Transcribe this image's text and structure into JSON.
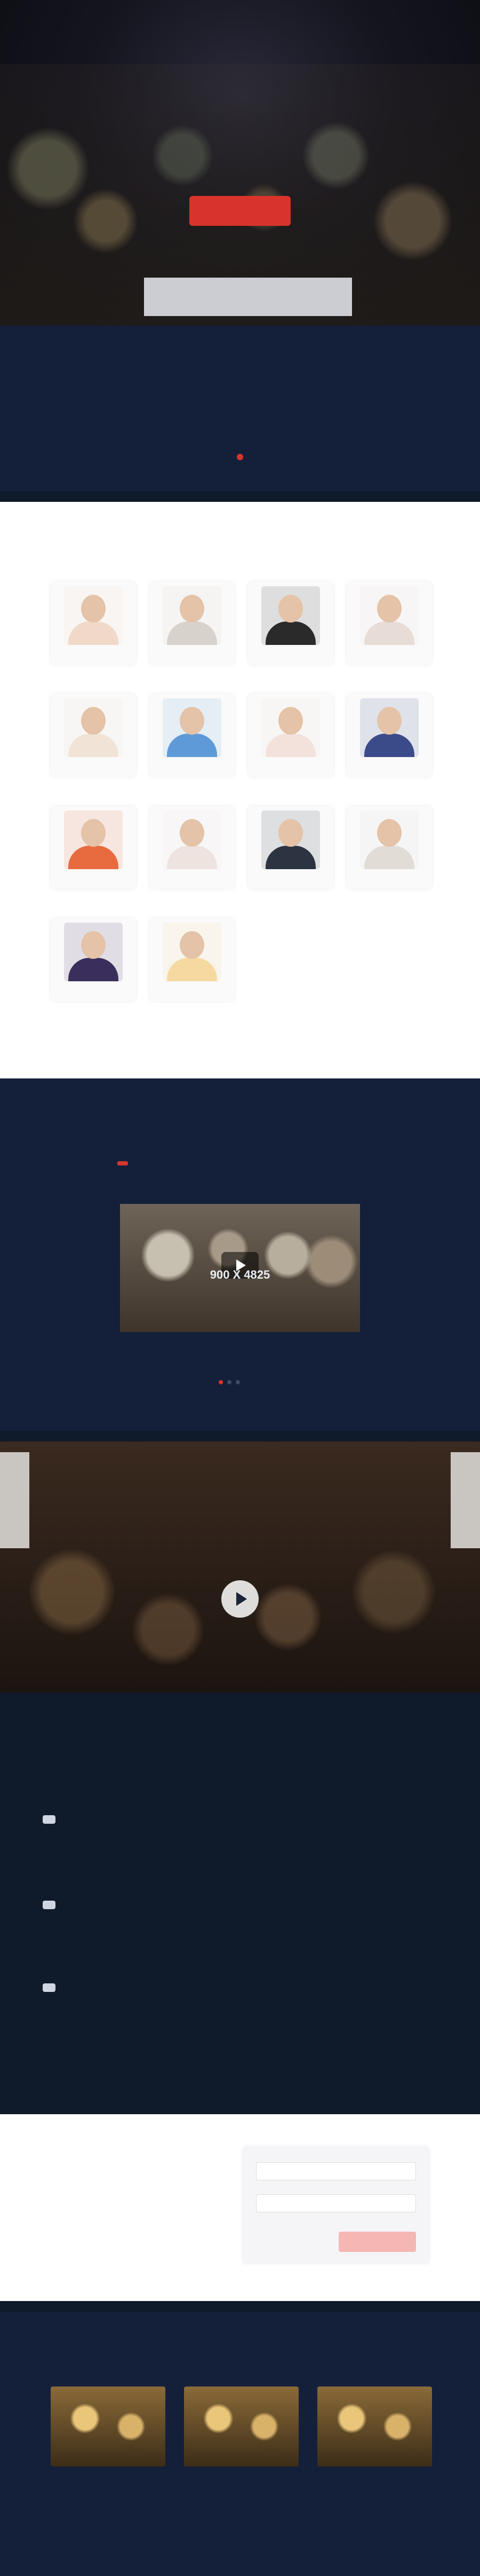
{
  "nav": {
    "logo": "",
    "items": []
  },
  "hero": {
    "title": "",
    "subtitle": "",
    "button": "",
    "banner": ""
  },
  "intro": {
    "title": "",
    "text": ""
  },
  "speakers": {
    "title": "",
    "subtitle": "",
    "cards": [
      {
        "name": "",
        "role": "",
        "color": "#f0d9c8"
      },
      {
        "name": "",
        "role": "",
        "color": "#d8d2cc"
      },
      {
        "name": "",
        "role": "",
        "color": "#2a2a2a"
      },
      {
        "name": "",
        "role": "",
        "color": "#e8ddd6"
      },
      {
        "name": "",
        "role": "",
        "color": "#f1e4d6"
      },
      {
        "name": "",
        "role": "",
        "color": "#5f9ad8"
      },
      {
        "name": "",
        "role": "",
        "color": "#f3e1dc"
      },
      {
        "name": "",
        "role": "",
        "color": "#3b4b8a"
      },
      {
        "name": "",
        "role": "",
        "color": "#e86a3f"
      },
      {
        "name": "",
        "role": "",
        "color": "#efe3df"
      },
      {
        "name": "",
        "role": "",
        "color": "#2c3441"
      },
      {
        "name": "",
        "role": "",
        "color": "#e2dcd6"
      },
      {
        "name": "",
        "role": "",
        "color": "#3a2f5c"
      },
      {
        "name": "",
        "role": "",
        "color": "#f6d9a0"
      }
    ]
  },
  "video": {
    "title": "",
    "tabs": [
      {
        "label": "",
        "active": true
      },
      {
        "label": "",
        "active": false
      },
      {
        "label": "",
        "active": false
      }
    ],
    "placeholder": "900 X 4825",
    "caption": "",
    "caption_sub": ""
  },
  "cta": {
    "title": "",
    "subtitle": ""
  },
  "agenda": {
    "title": "",
    "rows": [
      {
        "label": "",
        "items": [
          "",
          "",
          "",
          ""
        ]
      },
      {
        "label": "",
        "items": [
          "",
          "",
          "",
          "",
          "",
          ""
        ]
      },
      {
        "label": "",
        "items": [
          "",
          "",
          "",
          "",
          "",
          ""
        ]
      }
    ]
  },
  "newsletter": {
    "title": "",
    "text": "",
    "name_placeholder": "",
    "email_placeholder": "",
    "submit": ""
  },
  "blog": {
    "title": "",
    "subtitle": "",
    "posts": [
      {
        "meta": "",
        "title": ""
      },
      {
        "meta": "",
        "title": ""
      },
      {
        "meta": "",
        "title": ""
      }
    ],
    "footer": ""
  },
  "colors": {
    "accent": "#d9342b",
    "dark": "#14203a"
  }
}
